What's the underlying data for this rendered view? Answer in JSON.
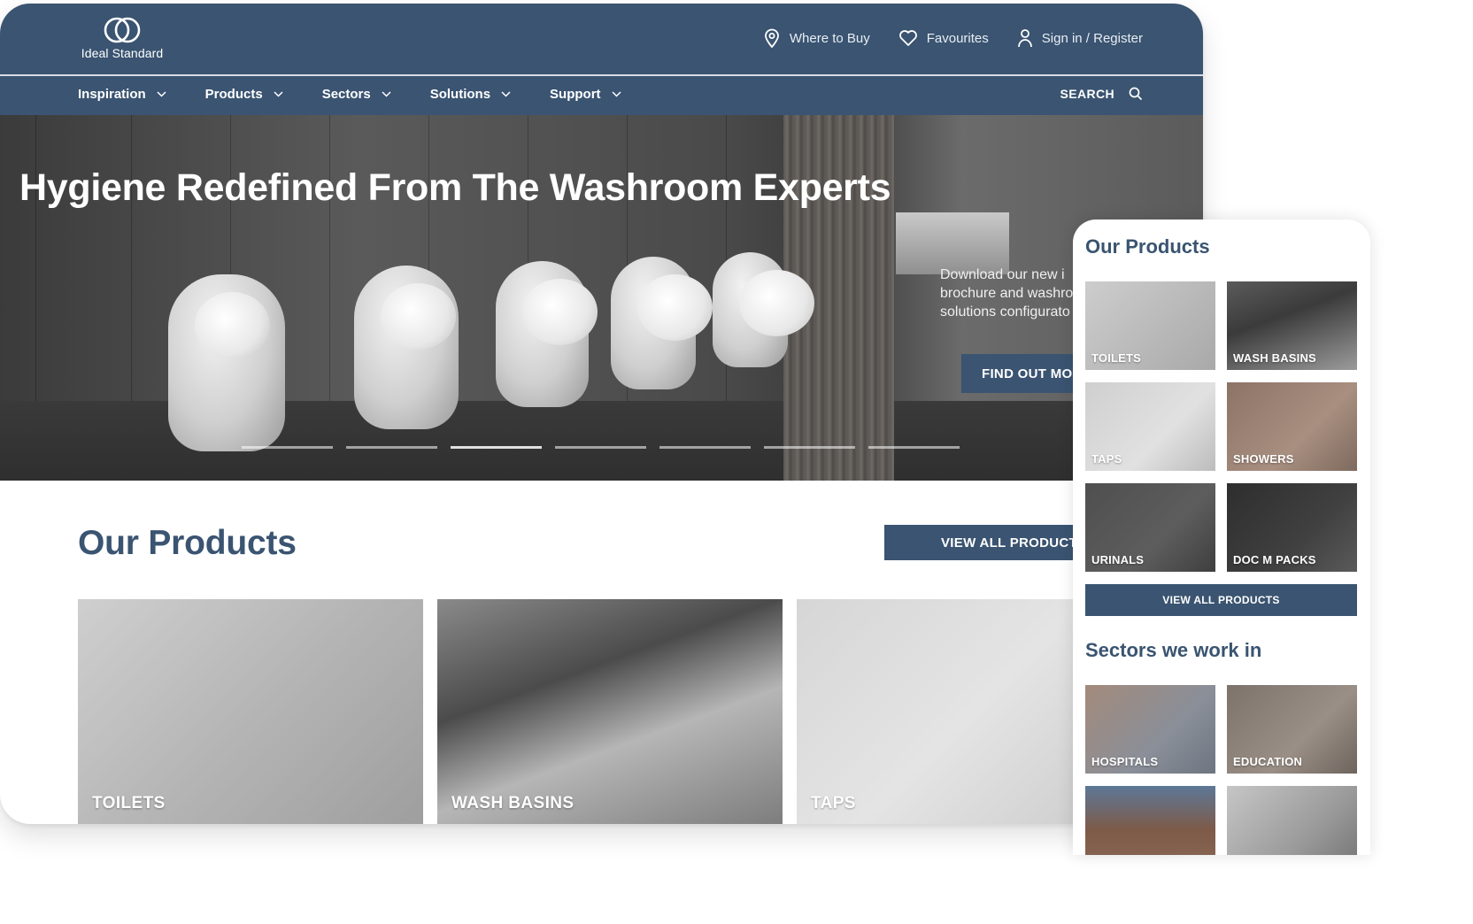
{
  "brand": {
    "name": "Ideal Standard",
    "accent": "#3a5471"
  },
  "header": {
    "utility_links": [
      {
        "label": "Where to Buy",
        "icon": "location-pin-icon"
      },
      {
        "label": "Favourites",
        "icon": "heart-icon"
      },
      {
        "label": "Sign in / Register",
        "icon": "user-icon"
      }
    ]
  },
  "nav": {
    "items": [
      {
        "label": "Inspiration"
      },
      {
        "label": "Products"
      },
      {
        "label": "Sectors"
      },
      {
        "label": "Solutions"
      },
      {
        "label": "Support"
      }
    ],
    "search_label": "SEARCH"
  },
  "hero": {
    "title": "Hygiene Redefined From The Washroom Experts",
    "description_lines": [
      "Download our new i",
      "brochure and washro",
      "solutions configurato"
    ],
    "cta_label": "FIND OUT MO",
    "slides_total": 7,
    "active_slide": 3
  },
  "desktop_products": {
    "title": "Our Products",
    "view_all_label": "VIEW ALL PRODUCT",
    "cards": [
      {
        "label": "TOILETS"
      },
      {
        "label": "WASH BASINS"
      },
      {
        "label": "TAPS"
      }
    ]
  },
  "mobile": {
    "products_title": "Our Products",
    "products": [
      {
        "label": "TOILETS"
      },
      {
        "label": "WASH BASINS"
      },
      {
        "label": "TAPS"
      },
      {
        "label": "SHOWERS"
      },
      {
        "label": "URINALS"
      },
      {
        "label": "DOC M PACKS"
      }
    ],
    "view_all_label": "VIEW ALL PRODUCTS",
    "sectors_title": "Sectors we work in",
    "sectors": [
      {
        "label": "HOSPITALS"
      },
      {
        "label": "EDUCATION"
      },
      {
        "label": ""
      },
      {
        "label": ""
      }
    ]
  }
}
